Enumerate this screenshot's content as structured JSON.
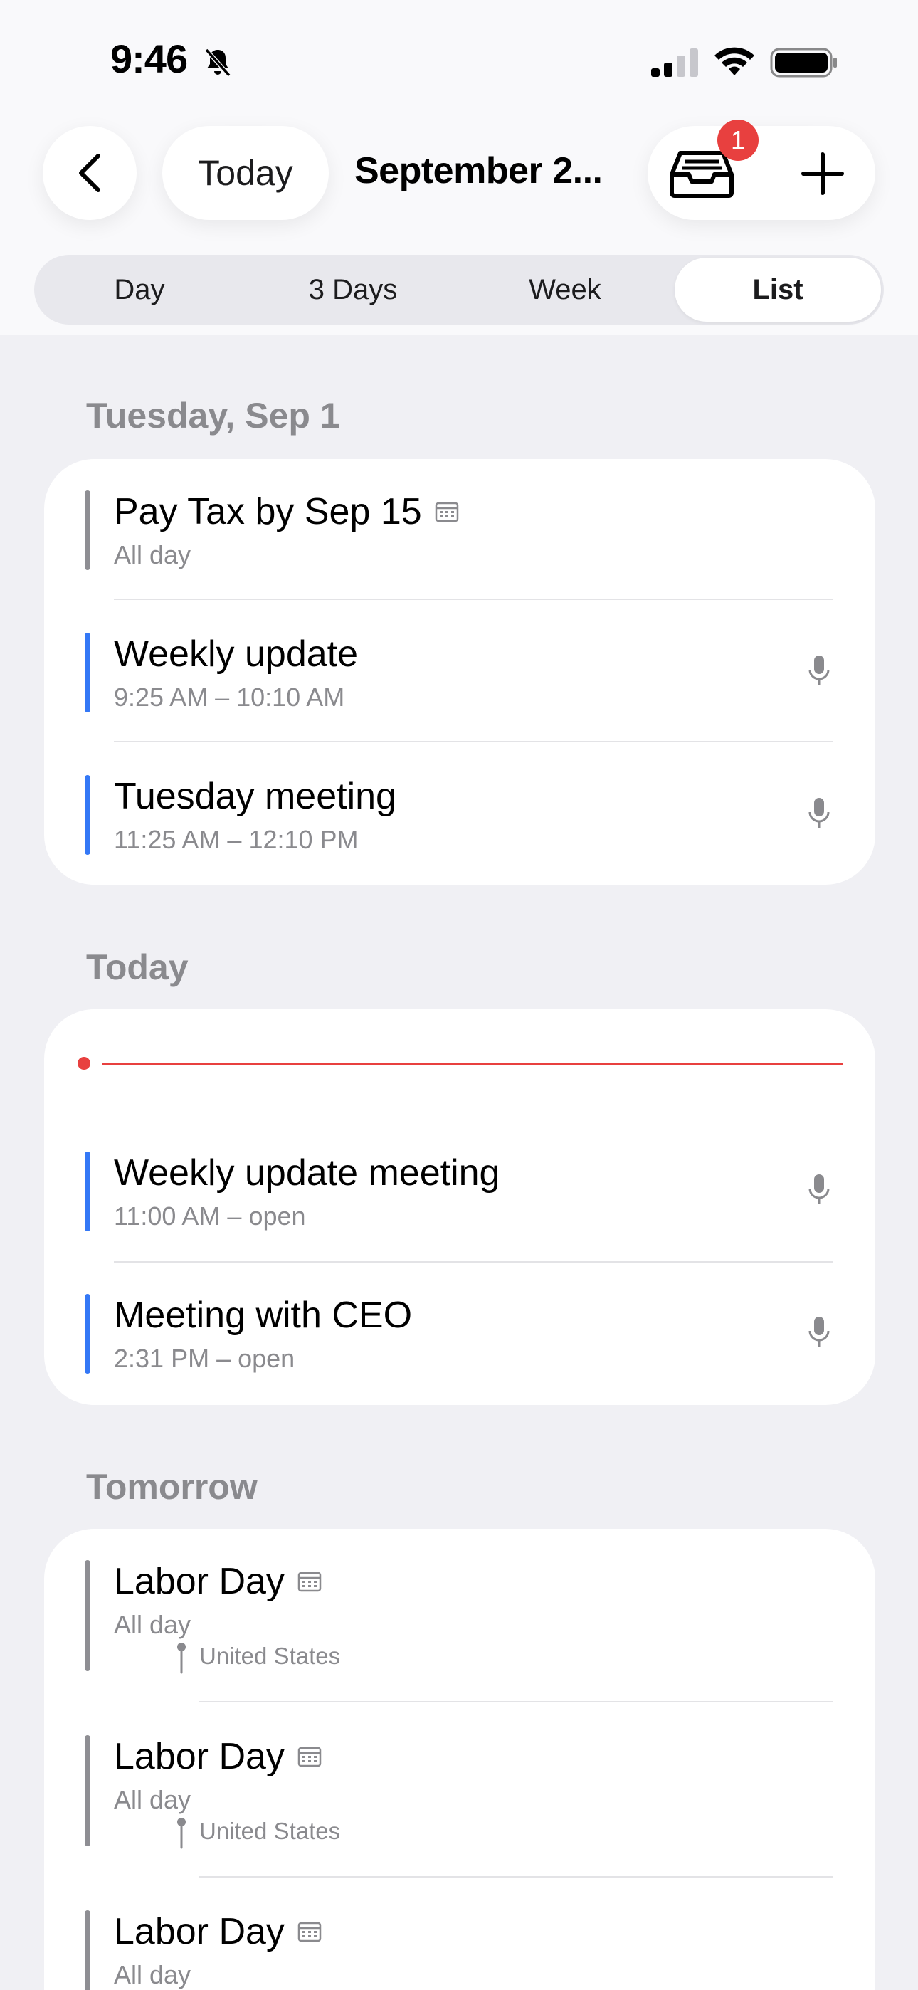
{
  "status_bar": {
    "time": "9:46"
  },
  "header": {
    "today_label": "Today",
    "title": "September 2...",
    "inbox_badge": "1"
  },
  "view_switcher": {
    "options": [
      "Day",
      "3 Days",
      "Week",
      "List"
    ],
    "selected": "List"
  },
  "sections": [
    {
      "title": "Tuesday, Sep 1",
      "events": [
        {
          "title": "Pay Tax by Sep 15",
          "subtitle": "All day",
          "bar_color": "#8e8e93"
        },
        {
          "title": "Weekly update",
          "subtitle": "9:25 AM – 10:10 AM",
          "bar_color": "#3478f6"
        },
        {
          "title": "Tuesday meeting",
          "subtitle": "11:25 AM – 12:10 PM",
          "bar_color": "#3478f6"
        }
      ]
    },
    {
      "title": "Today",
      "events": [
        {
          "title": "Weekly update meeting",
          "subtitle": "11:00 AM – open",
          "bar_color": "#3478f6"
        },
        {
          "title": "Meeting with CEO",
          "subtitle": "2:31 PM – open",
          "bar_color": "#3478f6"
        }
      ]
    },
    {
      "title": "Tomorrow",
      "events": [
        {
          "title": "Labor Day",
          "subtitle": "All day",
          "location": "United States",
          "bar_color": "#8e8e93"
        },
        {
          "title": "Labor Day",
          "subtitle": "All day",
          "location": "United States",
          "bar_color": "#8e8e93"
        },
        {
          "title": "Labor Day",
          "subtitle": "All day",
          "bar_color": "#8e8e93"
        }
      ]
    }
  ],
  "colors": {
    "accent_blue": "#3478f6",
    "now_red": "#e8403f",
    "badge_red": "#e8403f"
  }
}
